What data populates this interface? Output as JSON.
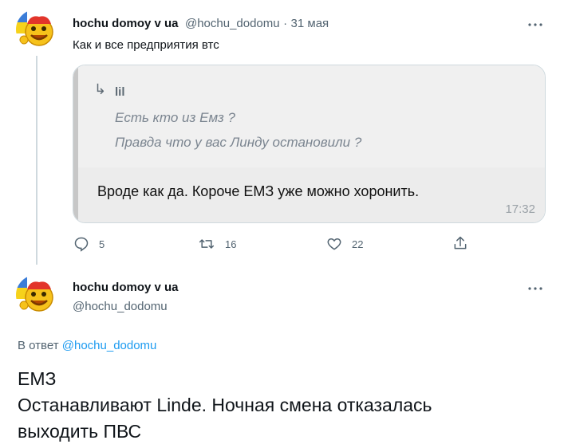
{
  "tweet1": {
    "author_name": "hochu domoy v ua",
    "author_handle": "@hochu_dodomu",
    "separator": "·",
    "date": "31 мая",
    "more_icon": "more-horizontal-icon",
    "text": "Как и все предприятия втс",
    "media": {
      "quote_author": "lil",
      "quote_lines": [
        "Есть кто из Емз ?",
        "Правда что у вас Линду остановили ?"
      ],
      "message": "Вроде как да. Короче ЕМЗ уже можно хоронить.",
      "time": "17:32"
    },
    "actions": {
      "reply_count": "5",
      "retweet_count": "16",
      "like_count": "22"
    }
  },
  "tweet2": {
    "author_name": "hochu domoy v ua",
    "author_handle": "@hochu_dodomu",
    "reply_prefix": "В ответ",
    "reply_handle": "@hochu_dodomu",
    "text_lines": [
      "ЕМЗ",
      "Останавливают Linde. Ночная смена отказалась",
      "выходить ПВС"
    ]
  },
  "colors": {
    "secondary": "#536471",
    "link": "#1d9bf0",
    "text": "#0f1419",
    "avatar_face": "#f6c21b"
  }
}
